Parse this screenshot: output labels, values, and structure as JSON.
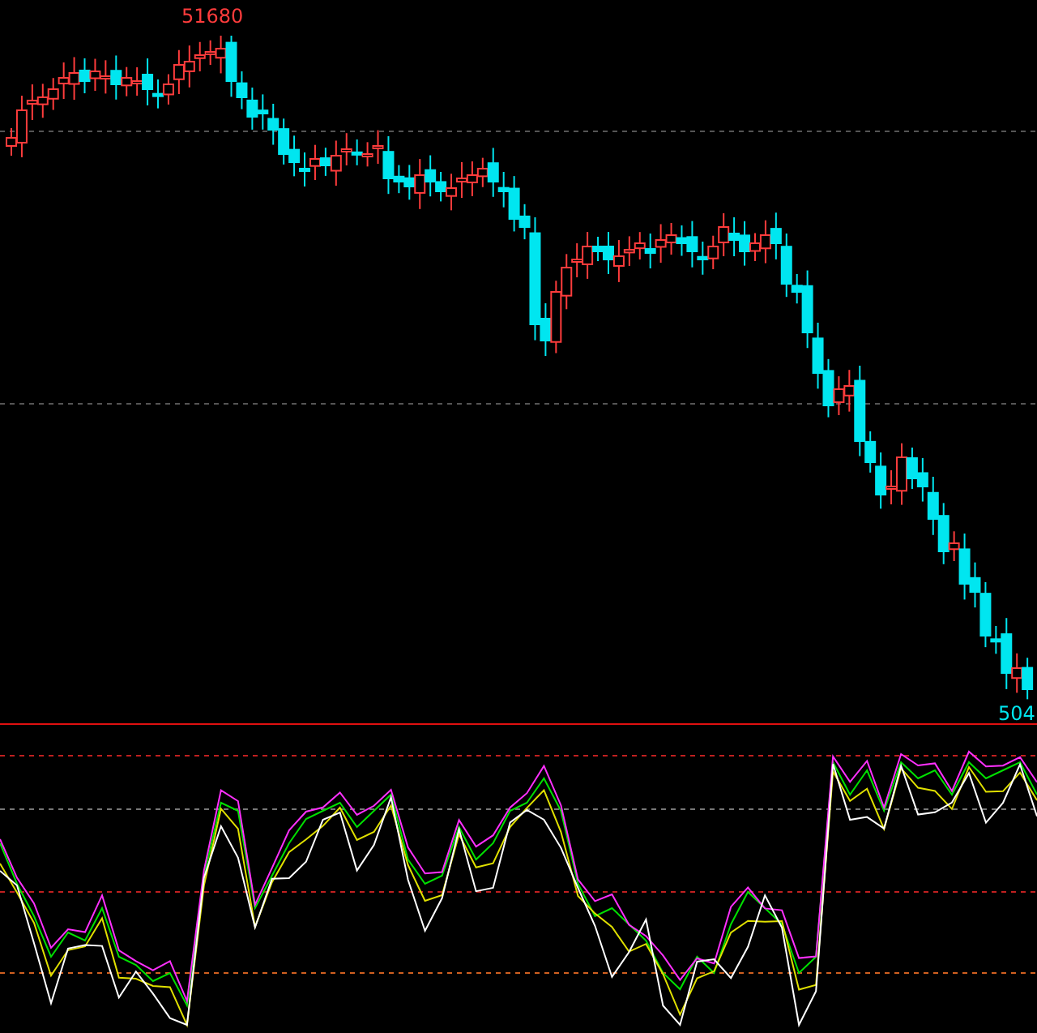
{
  "price_panel": {
    "high_label": "51680",
    "last_label": "504"
  }
}
